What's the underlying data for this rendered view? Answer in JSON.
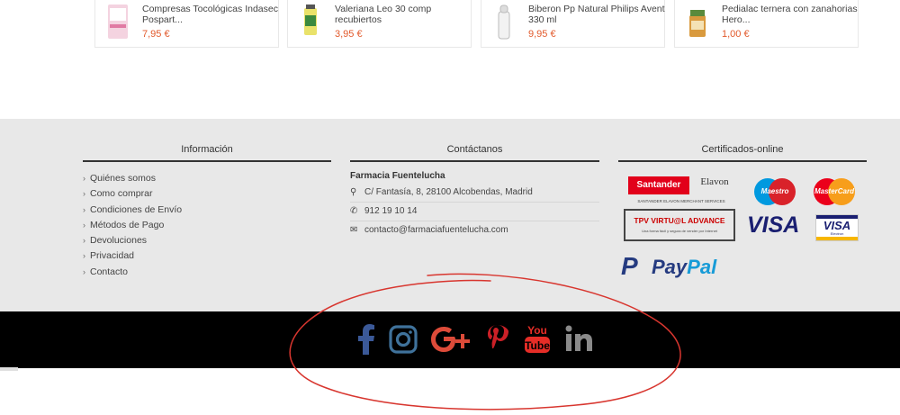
{
  "products": [
    {
      "name": "Compresas Tocológicas Indasec Pospart...",
      "price": "7,95 €"
    },
    {
      "name": "Valeriana Leo 30 comp recubiertos",
      "price": "3,95 €"
    },
    {
      "name": "Biberon Pp Natural Philips Avent 330 ml",
      "price": "9,95 €"
    },
    {
      "name": "Pedialac ternera con zanahorias Hero...",
      "price": "1,00 €"
    }
  ],
  "footer": {
    "info": {
      "title": "Información",
      "links": [
        "Quiénes somos",
        "Como comprar",
        "Condiciones de Envío",
        "Métodos de Pago",
        "Devoluciones",
        "Privacidad",
        "Contacto"
      ]
    },
    "contact": {
      "title": "Contáctanos",
      "name": "Farmacia Fuentelucha",
      "address": "C/ Fantasía, 8, 28100 Alcobendas, Madrid",
      "phone": "912 19 10 14",
      "email": "contacto@farmaciafuentelucha.com"
    },
    "certs": {
      "title": "Certificados-online",
      "santander": "Santander",
      "elavon": "Elavon",
      "santander_sub": "SANTANDER ELAVON MERCHANT SERVICES",
      "tpv_title": "TPV VIRTU@L ADVANCE",
      "tpv_sub": "Una forma fácil y segura de vender por Internet",
      "maestro": "Maestro",
      "mastercard": "MasterCard",
      "visa": "VISA",
      "visa_electron": "VISA",
      "visa_electron_sub": "Electron",
      "paypal_pay": "Pay",
      "paypal_pal": "Pal"
    }
  },
  "social": [
    "facebook",
    "instagram",
    "google-plus",
    "pinterest",
    "youtube",
    "linkedin"
  ],
  "colors": {
    "price": "#e2592b",
    "footer_bg": "#e8e8e8",
    "social_bg": "#000000",
    "facebook": "#3b5998",
    "instagram": "#3f729b",
    "google": "#dd4b39",
    "pinterest": "#cb2027",
    "youtube": "#e52d27",
    "linkedin": "#8a8a8a",
    "annotation": "#d8362f"
  }
}
